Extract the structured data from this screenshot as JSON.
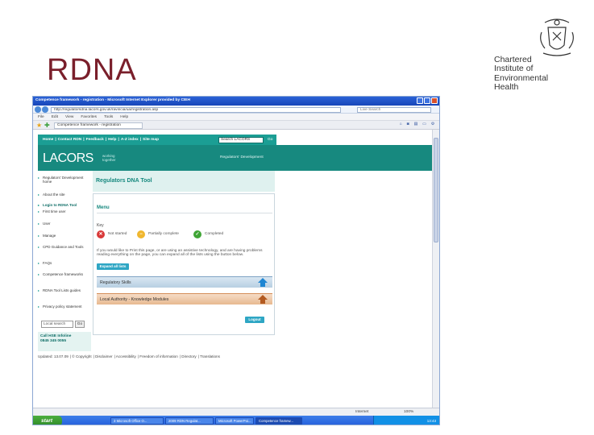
{
  "slide": {
    "title": "RDNA",
    "org_lines": [
      "Chartered",
      "Institute of",
      "Environmental",
      "Health"
    ]
  },
  "browser": {
    "window_title": "Competence framework - registration - Microsoft Internet Explorer provided by CIEH",
    "url": "http://regulatorsdna.lacors.gov.uk/ravincia/ua/registration.asp",
    "search_placeholder": "Live Search",
    "menu": [
      "File",
      "Edit",
      "View",
      "Favorites",
      "Tools",
      "Help"
    ],
    "tab_label": "Competence framework - registration",
    "cmd_icons": [
      "home-icon",
      "feeds-icon",
      "print-icon",
      "page-menu-icon",
      "tools-menu-icon"
    ]
  },
  "site": {
    "topnav": [
      "Home",
      "Contact RDN",
      "Feedback",
      "Help",
      "A-Z index",
      "Site map"
    ],
    "search_value": "Search LACORS",
    "search_go": "Go",
    "logo": "LACORS",
    "logo_sub": [
      "working",
      "together"
    ],
    "banner_right": "Regulators' Development",
    "sidebar": [
      "Regulators' Development home",
      "About the site",
      "Login to RDNA Tool",
      "First time user",
      "User",
      "Manage",
      "CPD Guidance and Tools",
      "FAQs",
      "Competence frameworks",
      "RDNA Tool Lists guides",
      "Privacy policy statement"
    ],
    "side_search": "Local search",
    "side_go": "Go",
    "helpline": [
      "Call HSE Infoline",
      "0845 345 0055"
    ],
    "tool_title": "Regulators DNA Tool",
    "menu_heading": "Menu",
    "key_heading": "Key",
    "key": [
      {
        "label": "Not started",
        "color": "#d93a3a",
        "glyph": "✕"
      },
      {
        "label": "Partially complete",
        "color": "#f0b72f",
        "glyph": "−"
      },
      {
        "label": "Completed",
        "color": "#3fa535",
        "glyph": "✓"
      }
    ],
    "note": "If you would like to Print this page, or are using an assistive technology, and are having problems reading everything on the page, you can expand all of the lists using the button below.",
    "expand_label": "Expand all lists",
    "modules": [
      {
        "label": "Regulatory Skills",
        "arrow_color": "#1f86d2"
      },
      {
        "label": "Local Authority - Knowledge Modules",
        "arrow_color": "#e06a1f"
      }
    ],
    "logout_label": "Logout",
    "footer": [
      "Updated: 13.07.09",
      "© Copyright",
      "Disclaimer",
      "Accessibility",
      "Freedom of information",
      "Directory",
      "Translations"
    ]
  },
  "status": {
    "zone": "Internet",
    "zoom": "100%"
  },
  "taskbar": {
    "start": "start",
    "tasks": [
      "3 Microsoft Office O...",
      "2009 RDN Regulat...",
      "Microsoft PowerPoi...",
      "Competence framew..."
    ],
    "clock": "13:43"
  }
}
